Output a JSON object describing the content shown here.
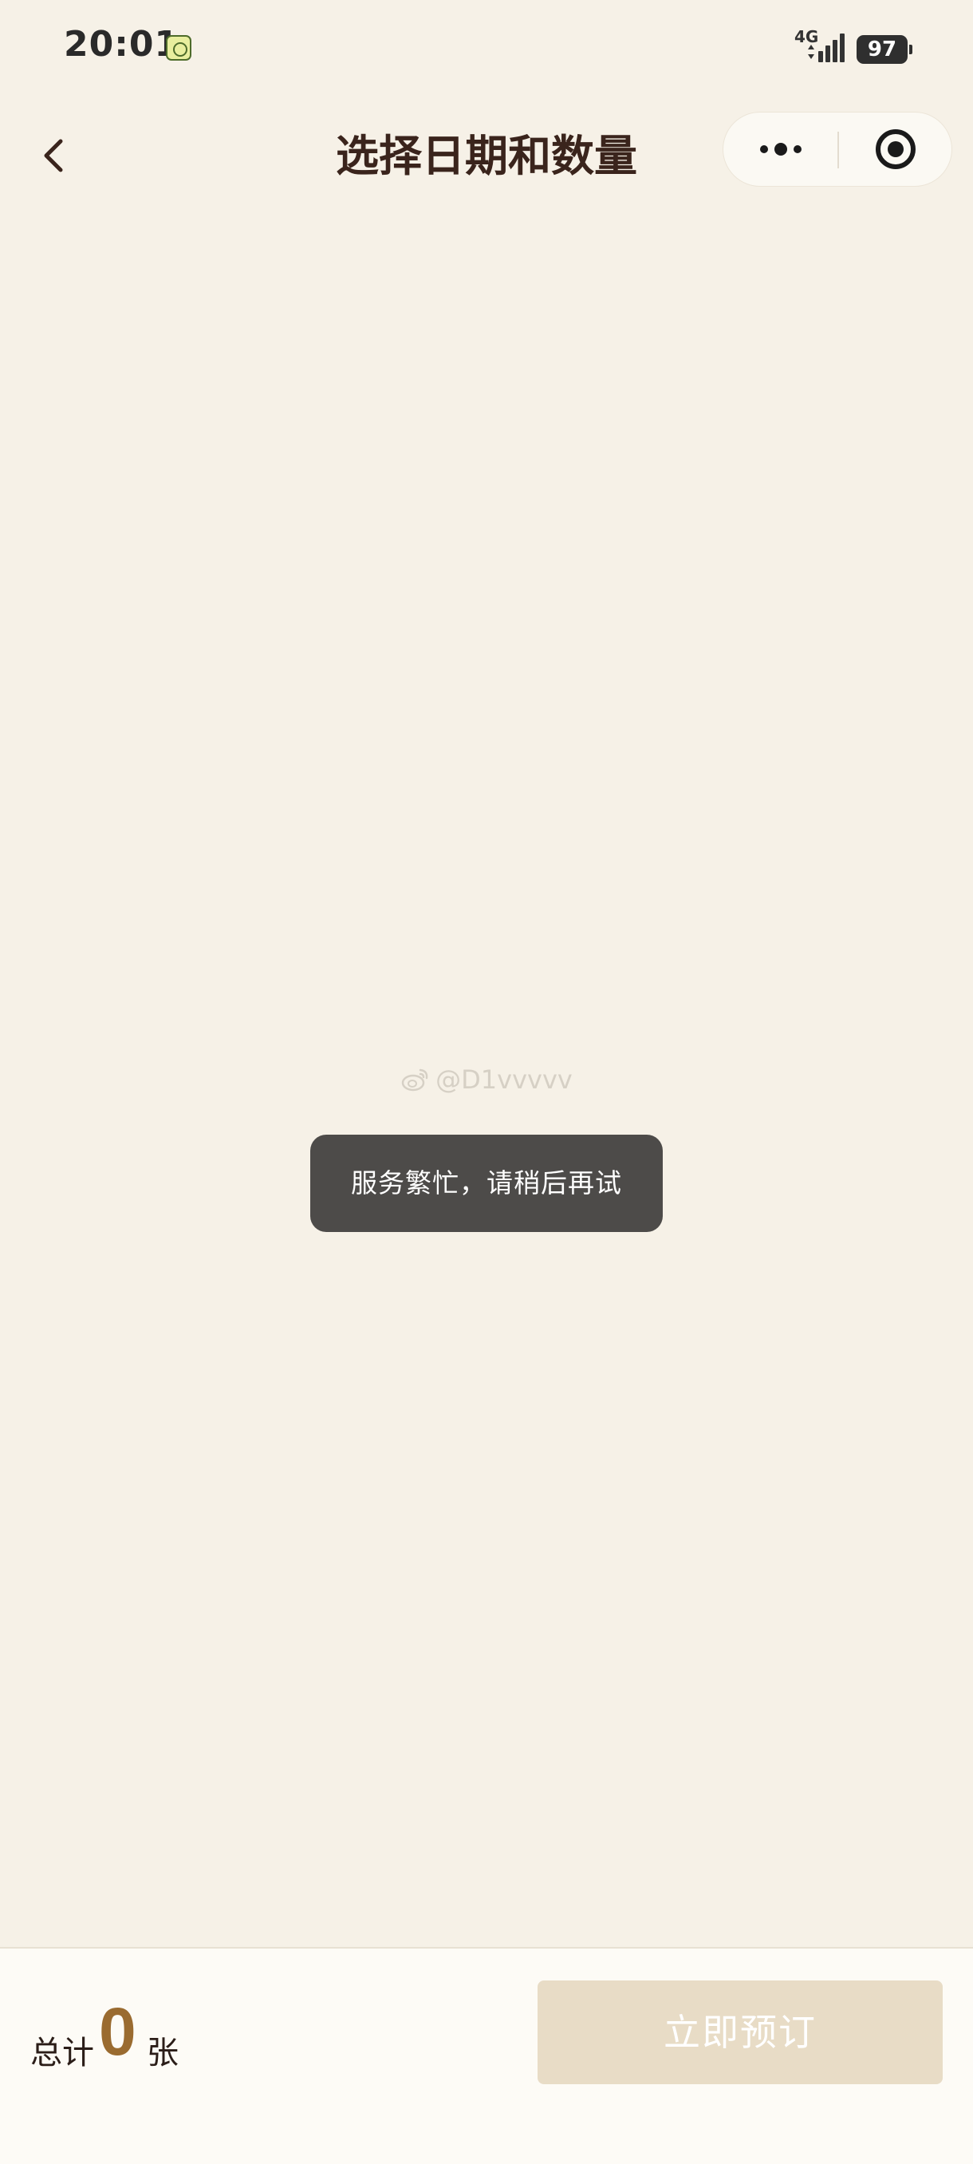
{
  "status_bar": {
    "time": "20:01",
    "network": "4G",
    "battery": "97"
  },
  "header": {
    "title": "选择日期和数量"
  },
  "watermark": {
    "text": "@D1vvvvv"
  },
  "toast": {
    "message": "服务繁忙，请稍后再试"
  },
  "footer": {
    "total_prefix": "总计",
    "total_count": "0",
    "total_unit": "张",
    "book_label": "立即预订"
  },
  "colors": {
    "background": "#f6f1e7",
    "accent": "#9a6b30",
    "button_disabled": "#e8dcc6",
    "toast_bg": "#4d4b49"
  },
  "icons": [
    "back-arrow-icon",
    "more-dots-icon",
    "close-target-icon",
    "weibo-icon",
    "signal-icon",
    "battery-icon"
  ]
}
